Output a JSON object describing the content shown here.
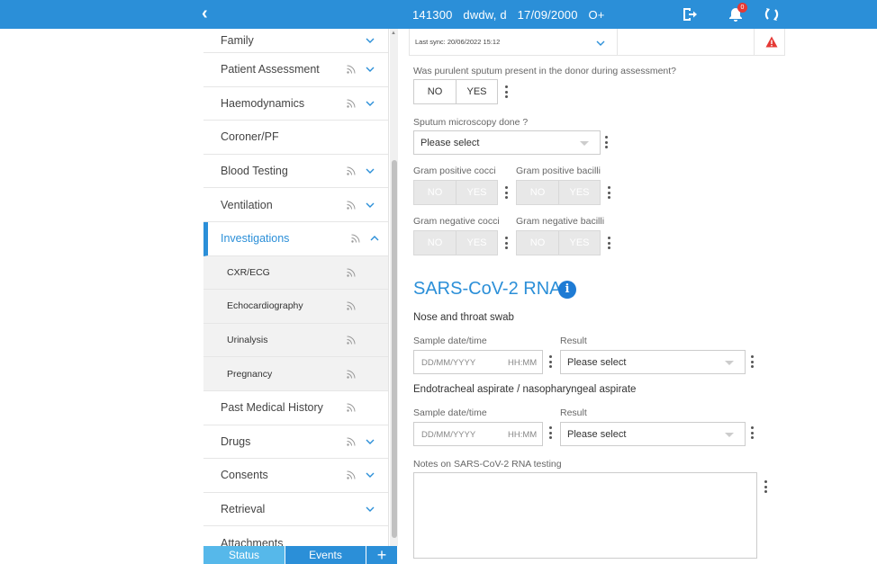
{
  "topbar": {
    "back_icon": "chevron-left",
    "patient_id": "141300",
    "patient_name": "dwdw, d",
    "dob": "17/09/2000",
    "blood_group": "O+",
    "notification_count": "0",
    "bar_color": "#2b8fd8"
  },
  "sidebar": {
    "items": [
      {
        "label": "Family"
      },
      {
        "label": "Patient Assessment"
      },
      {
        "label": "Haemodynamics"
      },
      {
        "label": "Coroner/PF"
      },
      {
        "label": "Blood Testing"
      },
      {
        "label": "Ventilation"
      },
      {
        "label": "Investigations"
      },
      {
        "label": "CXR/ECG"
      },
      {
        "label": "Echocardiography"
      },
      {
        "label": "Urinalysis"
      },
      {
        "label": "Pregnancy"
      },
      {
        "label": "Past Medical History"
      },
      {
        "label": "Drugs"
      },
      {
        "label": "Consents"
      },
      {
        "label": "Retrieval"
      },
      {
        "label": "Attachments"
      }
    ],
    "active_item": "Investigations"
  },
  "bottom_bar": {
    "status_label": "Status",
    "events_label": "Events",
    "add_label": "+"
  },
  "main": {
    "last_sync": "Last sync: 20/06/2022 15:12",
    "purulent_question": "Was purulent sputum present in the donor during assessment?",
    "no_label": "NO",
    "yes_label": "YES",
    "sputum_question": "Sputum microscopy done ?",
    "please_select": "Please select",
    "gram_pos_cocci": "Gram positive cocci",
    "gram_pos_bacilli": "Gram positive bacilli",
    "gram_neg_cocci": "Gram negative cocci",
    "gram_neg_bacilli": "Gram negative bacilli",
    "sars_title": "SARS-CoV-2 RNA",
    "info_icon": "i",
    "nose_throat": "Nose and throat swab",
    "sample_datetime": "Sample date/time",
    "result": "Result",
    "date_placeholder": "DD/MM/YYYY",
    "time_placeholder": "HH:MM",
    "endotracheal": "Endotracheal aspirate / nasopharyngeal aspirate",
    "notes_label": "Notes on SARS-CoV-2 RNA testing"
  }
}
